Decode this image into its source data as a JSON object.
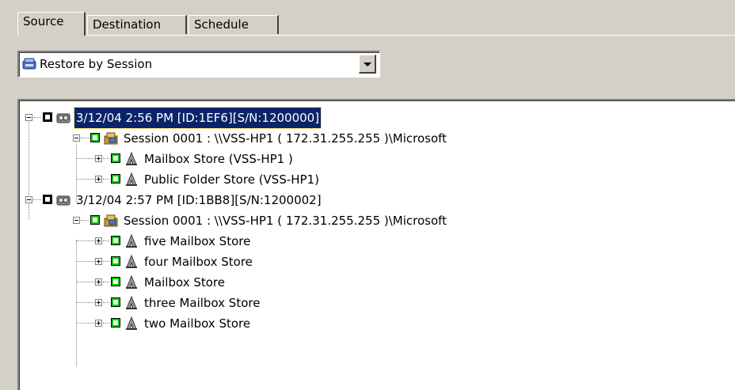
{
  "tabs": [
    {
      "label": "Source",
      "active": true
    },
    {
      "label": "Destination",
      "active": false
    },
    {
      "label": "Schedule",
      "active": false
    }
  ],
  "restore_mode": {
    "selected": "Restore by Session",
    "icon": "tape-drive-icon"
  },
  "tree": {
    "nodes": [
      {
        "label": "3/12/04 2:56 PM [ID:1EF6][S/N:1200000]",
        "level": 0,
        "expander": "minus",
        "check": "partial",
        "icon": "tape-icon",
        "selected": true
      },
      {
        "label": "Session 0001 : \\\\VSS-HP1  ( 172.31.255.255 )\\Microsoft",
        "level": 1,
        "expander": "minus",
        "check": "green",
        "icon": "session-icon",
        "selected": false
      },
      {
        "label": "Mailbox Store (VSS-HP1 )",
        "level": 2,
        "expander": "plus",
        "check": "green",
        "icon": "store-icon",
        "selected": false
      },
      {
        "label": "Public Folder Store (VSS-HP1)",
        "level": 2,
        "expander": "plus",
        "check": "green",
        "icon": "store-icon",
        "selected": false
      },
      {
        "label": "3/12/04 2:57 PM [ID:1BB8][S/N:1200002]",
        "level": 0,
        "expander": "minus",
        "check": "partial",
        "icon": "tape-icon",
        "selected": false
      },
      {
        "label": "Session 0001 : \\\\VSS-HP1  ( 172.31.255.255 )\\Microsoft",
        "level": 1,
        "expander": "minus",
        "check": "green",
        "icon": "session-icon",
        "selected": false
      },
      {
        "label": "five Mailbox Store",
        "level": 2,
        "expander": "plus",
        "check": "green",
        "icon": "store-icon",
        "selected": false
      },
      {
        "label": "four Mailbox Store",
        "level": 2,
        "expander": "plus",
        "check": "green",
        "icon": "store-icon",
        "selected": false
      },
      {
        "label": "Mailbox Store",
        "level": 2,
        "expander": "plus",
        "check": "green",
        "icon": "store-icon",
        "selected": false
      },
      {
        "label": "three Mailbox Store",
        "level": 2,
        "expander": "plus",
        "check": "green",
        "icon": "store-icon",
        "selected": false
      },
      {
        "label": "two Mailbox Store",
        "level": 2,
        "expander": "plus",
        "check": "green",
        "icon": "store-icon",
        "selected": false
      }
    ]
  },
  "colors": {
    "panel_bg": "#d4d0c8",
    "selection_bg": "#0a246a",
    "check_green": "#00c800"
  }
}
